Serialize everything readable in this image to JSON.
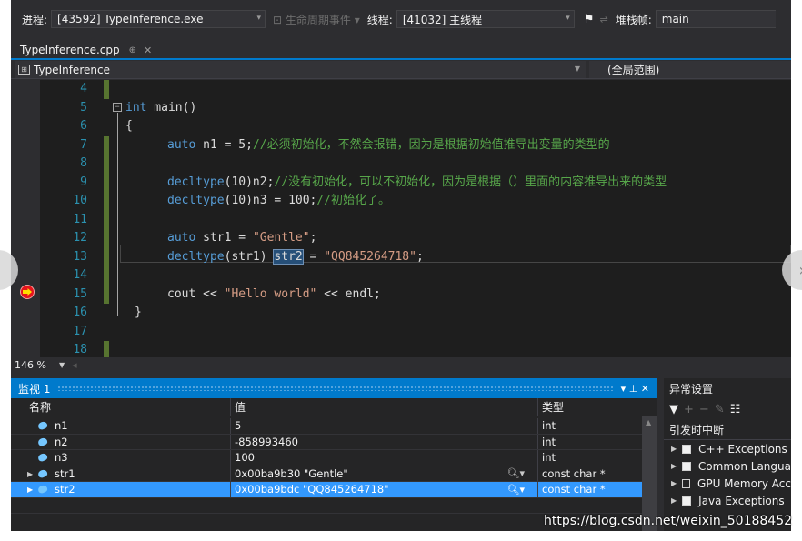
{
  "toolbar": {
    "process_label": "进程:",
    "process_value": "[43592] TypeInference.exe",
    "lifecycle_label": "生命周期事件",
    "thread_label": "线程:",
    "thread_value": "[41032] 主线程",
    "stackframe_label": "堆栈帧:",
    "stackframe_value": "main"
  },
  "tab": {
    "filename": "TypeInference.cpp",
    "pin": "⊕",
    "close": "✕"
  },
  "navbar": {
    "scope_left": "TypeInference",
    "scope_right": "(全局范围)"
  },
  "editor": {
    "line_numbers": [
      "4",
      "5",
      "6",
      "7",
      "8",
      "9",
      "10",
      "11",
      "12",
      "13",
      "14",
      "15",
      "16",
      "17",
      "18"
    ],
    "lines": {
      "l5_kw": "int",
      "l5_rest": " main()",
      "l6": "{",
      "l7_kw": "auto",
      "l7_code": " n1 = 5;",
      "l7_cm": "//必须初始化，不然会报错，因为是根据初始值推导出变量的类型的",
      "l9_kw": "decltype",
      "l9_code": "(10)n2;",
      "l9_cm": "//没有初始化，可以不初始化，因为是根据（）里面的内容推导出来的类型",
      "l10_kw": "decltype",
      "l10_code": "(10)n3 = 100;",
      "l10_cm": "//初始化了。",
      "l12_kw": "auto",
      "l12_code": " str1 = ",
      "l12_str": "\"Gentle\"",
      "l12_end": ";",
      "l13_kw": "decltype",
      "l13_code": "(str1) ",
      "l13_hl": "str2",
      "l13_mid": " = ",
      "l13_str": "\"QQ845264718\"",
      "l13_end": ";",
      "l15_code": "cout << ",
      "l15_str": "\"Hello world\"",
      "l15_end": " << endl;",
      "l16": "}"
    }
  },
  "zoom": {
    "level": "146 %"
  },
  "watch": {
    "title": "监视 1",
    "controls": "▾ ⊥ ✕",
    "columns": {
      "name": "名称",
      "value": "值",
      "type": "类型"
    },
    "rows": [
      {
        "name": "n1",
        "value": "5",
        "type": "int"
      },
      {
        "name": "n2",
        "value": "-858993460",
        "type": "int"
      },
      {
        "name": "n3",
        "value": "100",
        "type": "int"
      },
      {
        "name": "str1",
        "value": "0x00ba9b30 \"Gentle\"",
        "type": "const char *"
      },
      {
        "name": "str2",
        "value": "0x00ba9bdc \"QQ845264718\"",
        "type": "const char *"
      }
    ]
  },
  "exceptions": {
    "title": "异常设置",
    "subtitle": "引发时中断",
    "items": [
      {
        "label": "C++ Exceptions",
        "checked": true
      },
      {
        "label": "Common Langua",
        "checked": true
      },
      {
        "label": "GPU Memory Acc",
        "checked": false
      },
      {
        "label": "Java Exceptions",
        "checked": true
      }
    ]
  },
  "watermark": "https://blog.csdn.net/weixin_50188452"
}
